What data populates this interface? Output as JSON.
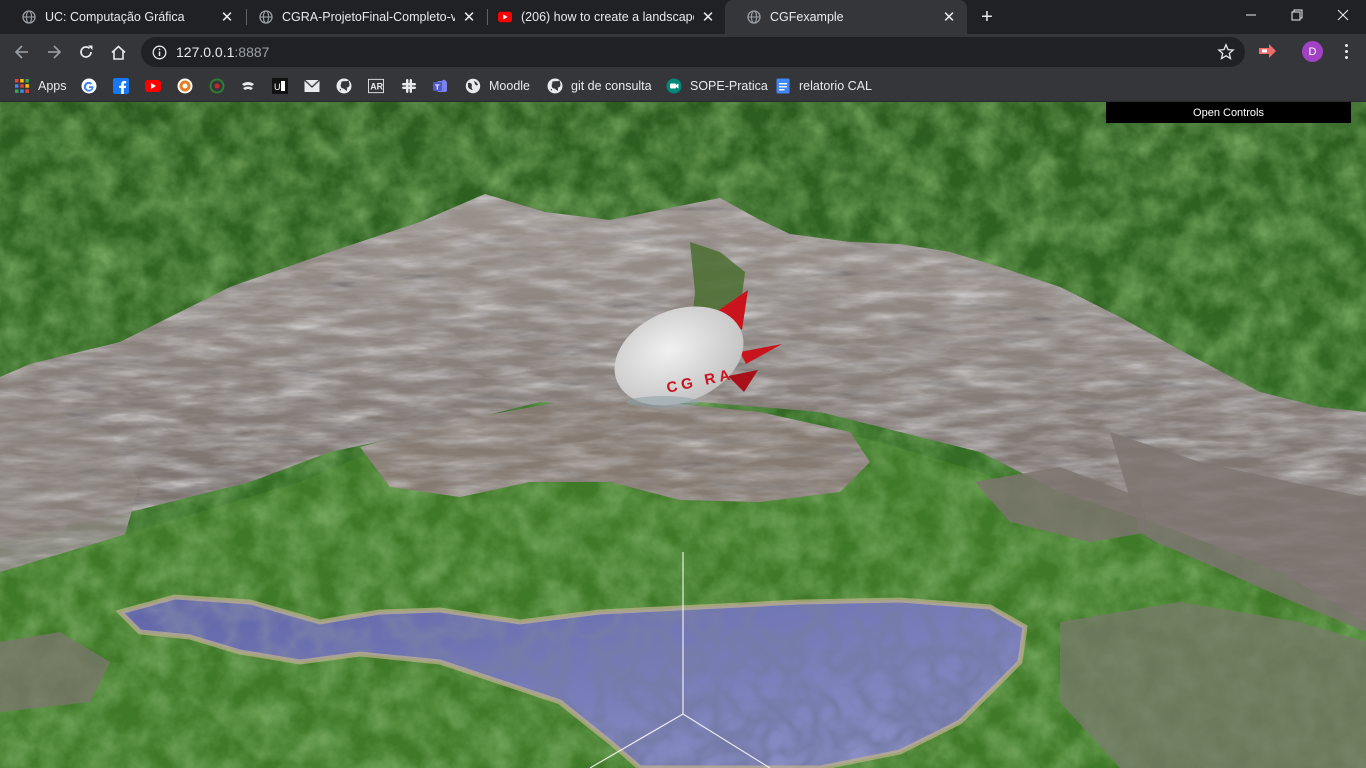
{
  "tabs": [
    {
      "title": "UC: Computação Gráfica",
      "favicon": "globe-icon",
      "active": false
    },
    {
      "title": "CGRA-ProjetoFinal-Completo-v2.",
      "favicon": "globe-icon",
      "active": false
    },
    {
      "title": "(206) how to create a landscape",
      "favicon": "youtube-icon",
      "active": false
    },
    {
      "title": "CGFexample",
      "favicon": "globe-icon",
      "active": true
    }
  ],
  "address": {
    "host": "127.0.0.1",
    "port": ":8887"
  },
  "profile_initial": "D",
  "bookmarks": [
    {
      "label": "Apps",
      "icon": "apps-grid-icon"
    },
    {
      "label": "",
      "icon": "google-icon"
    },
    {
      "label": "",
      "icon": "facebook-icon"
    },
    {
      "label": "",
      "icon": "youtube-icon"
    },
    {
      "label": "",
      "icon": "chrome-web-icon"
    },
    {
      "label": "",
      "icon": "circle-logo-icon"
    },
    {
      "label": "",
      "icon": "steam-icon"
    },
    {
      "label": "",
      "icon": "up-logo-icon"
    },
    {
      "label": "",
      "icon": "mail-icon"
    },
    {
      "label": "",
      "icon": "github-icon"
    },
    {
      "label": "",
      "icon": "ar-icon"
    },
    {
      "label": "",
      "icon": "slack-icon"
    },
    {
      "label": "",
      "icon": "teams-icon"
    },
    {
      "label": "Moodle",
      "icon": "globe-icon"
    },
    {
      "label": "git de consulta",
      "icon": "github-icon"
    },
    {
      "label": "SOPE-Pratica",
      "icon": "meet-icon"
    },
    {
      "label": "relatorio CAL",
      "icon": "docs-icon"
    }
  ],
  "scene": {
    "controls_label": "Open Controls",
    "blimp_text": "CG RA",
    "colors": {
      "grass": "#3f7a28",
      "rock": "#7d7470",
      "water": "#6f74b4",
      "blimp_body": "#dcdcdc",
      "blimp_fins": "#c9141d"
    }
  }
}
